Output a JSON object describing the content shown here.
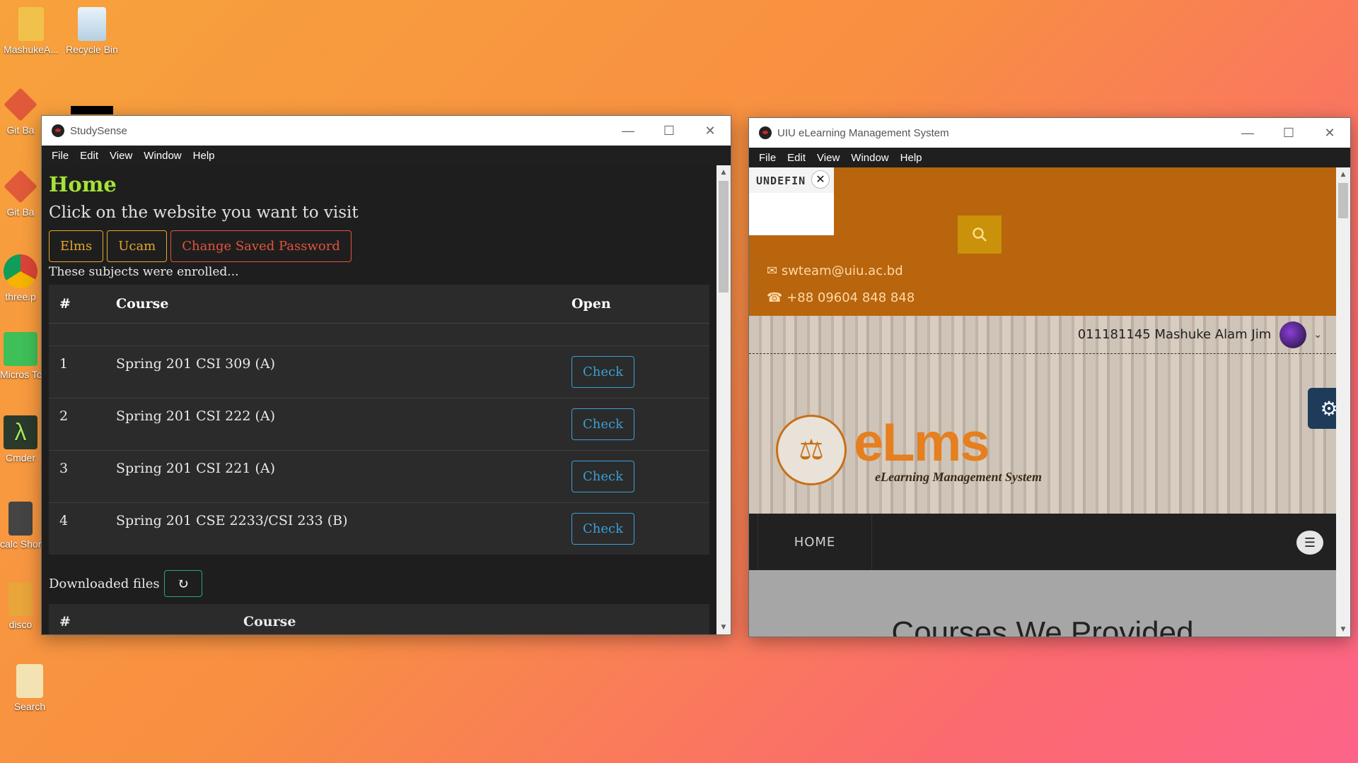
{
  "desktop": {
    "icons": [
      {
        "label": "MashukeA..."
      },
      {
        "label": "Recycle Bin"
      },
      {
        "label": "Git Ba"
      },
      {
        "label": "Git Ba"
      },
      {
        "label": "three.p"
      },
      {
        "label": "Micros To Do"
      },
      {
        "label": "Cmder"
      },
      {
        "label": "calc Shortc"
      },
      {
        "label": "disco"
      },
      {
        "label": "Search"
      }
    ]
  },
  "studysense": {
    "title": "StudySense",
    "menu": [
      "File",
      "Edit",
      "View",
      "Window",
      "Help"
    ],
    "heading": "Home",
    "subtitle": "Click on the website you want to visit",
    "buttons": {
      "elms": "Elms",
      "ucam": "Ucam",
      "change_password": "Change Saved Password"
    },
    "enrolled_text": "These subjects were enrolled...",
    "table": {
      "headers": [
        "#",
        "Course",
        "Open"
      ],
      "rows": [
        {
          "num": "1",
          "course": "Spring 201 CSI 309 (A)",
          "action": "Check"
        },
        {
          "num": "2",
          "course": "Spring 201 CSI 222 (A)",
          "action": "Check"
        },
        {
          "num": "3",
          "course": "Spring 201 CSI 221 (A)",
          "action": "Check"
        },
        {
          "num": "4",
          "course": "Spring 201 CSE 2233/CSI 233 (B)",
          "action": "Check"
        }
      ]
    },
    "downloaded_label": "Downloaded files",
    "downloaded_headers": [
      "#",
      "Course"
    ]
  },
  "uiu": {
    "title": "UIU eLearning Management System",
    "menu": [
      "File",
      "Edit",
      "View",
      "Window",
      "Help"
    ],
    "popup_label": "UNDEFIN",
    "email": "swteam@uiu.ac.bd",
    "phone": "+88 09604 848 848",
    "user": "011181145 Mashuke Alam Jim",
    "logo_text": "eLms",
    "logo_sub": "eLearning Management System",
    "nav_home": "HOME",
    "section_heading": "Courses We Provided"
  }
}
